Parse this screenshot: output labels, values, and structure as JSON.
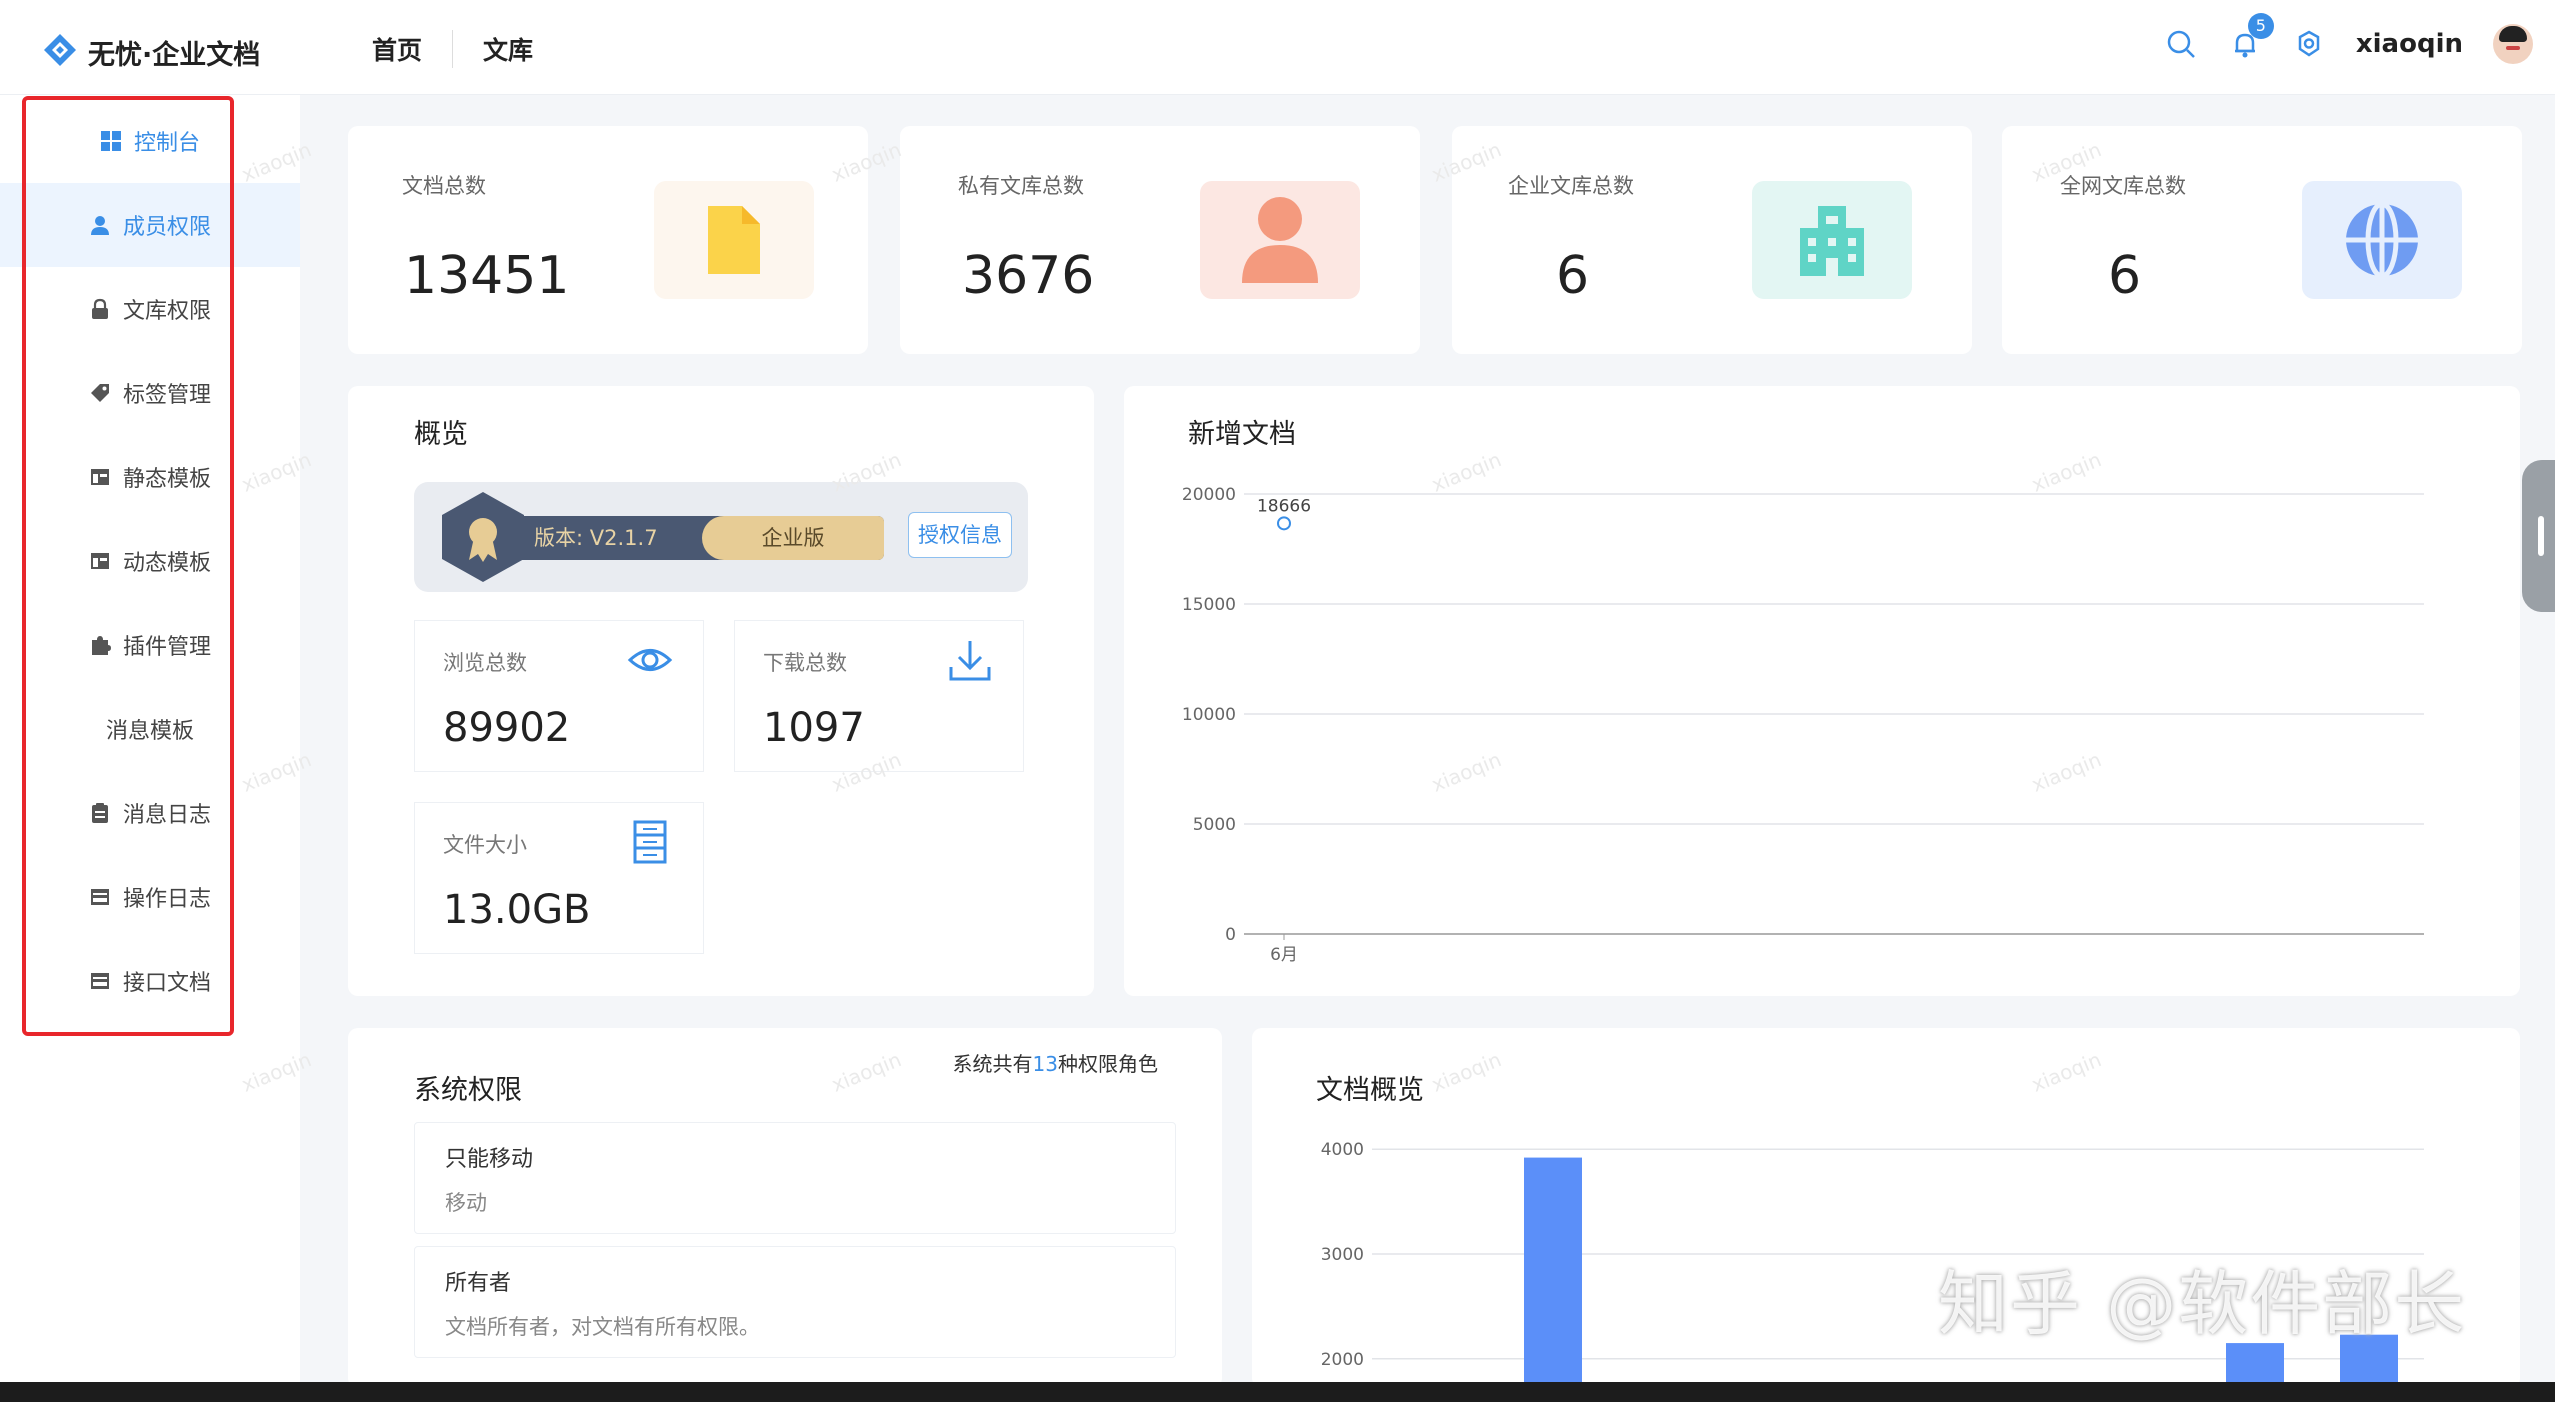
{
  "header": {
    "logo_text": "无忧·企业文档",
    "nav": [
      "首页",
      "文库"
    ],
    "notification_count": "5",
    "username": "xiaoqin"
  },
  "sidebar": {
    "items": [
      {
        "label": "控制台",
        "icon": "dashboard-icon"
      },
      {
        "label": "成员权限",
        "icon": "user-icon"
      },
      {
        "label": "文库权限",
        "icon": "lock-icon"
      },
      {
        "label": "标签管理",
        "icon": "tag-icon"
      },
      {
        "label": "静态模板",
        "icon": "template-icon"
      },
      {
        "label": "动态模板",
        "icon": "template-icon"
      },
      {
        "label": "插件管理",
        "icon": "puzzle-icon"
      },
      {
        "label": "消息模板",
        "icon": ""
      },
      {
        "label": "消息日志",
        "icon": "clipboard-icon"
      },
      {
        "label": "操作日志",
        "icon": "log-icon"
      },
      {
        "label": "接口文档",
        "icon": "api-doc-icon"
      }
    ]
  },
  "stats": [
    {
      "label": "文档总数",
      "value": "13451",
      "icon": "file-icon",
      "color": "#fbd34a",
      "bg": "#fdf6ee"
    },
    {
      "label": "私有文库总数",
      "value": "3676",
      "icon": "person-icon",
      "color": "#f49a7e",
      "bg": "#fce7e2"
    },
    {
      "label": "企业文库总数",
      "value": "6",
      "icon": "building-icon",
      "color": "#5fd4c6",
      "bg": "#e3f6f3"
    },
    {
      "label": "全网文库总数",
      "value": "6",
      "icon": "globe-icon",
      "color": "#6f9cf2",
      "bg": "#e6effd"
    }
  ],
  "overview": {
    "title": "概览",
    "version": "版本: V2.1.7",
    "edition": "企业版",
    "auth_button": "授权信息",
    "metrics": [
      {
        "label": "浏览总数",
        "value": "89902",
        "icon": "eye-icon"
      },
      {
        "label": "下载总数",
        "value": "1097",
        "icon": "download-icon"
      },
      {
        "label": "文件大小",
        "value": "13.0GB",
        "icon": "storage-icon"
      }
    ]
  },
  "new_docs": {
    "title": "新增文档"
  },
  "permissions": {
    "title": "系统权限",
    "summary_prefix": "系统共有",
    "summary_count": "13",
    "summary_suffix": "种权限角色",
    "items": [
      {
        "name": "只能移动",
        "desc": "移动"
      },
      {
        "name": "所有者",
        "desc": "文档所有者，对文档有所有权限。"
      }
    ]
  },
  "doc_overview": {
    "title": "文档概览"
  },
  "watermark_text": "xiaoqin",
  "overlay_text": "知乎 @软件部长",
  "chart_data": [
    {
      "type": "line",
      "title": "新增文档",
      "x": [
        "6月"
      ],
      "series": [
        {
          "values": [
            18666
          ]
        }
      ],
      "data_labels": [
        "18666"
      ],
      "ylim": [
        0,
        20000
      ],
      "yticks": [
        0,
        5000,
        10000,
        15000,
        20000
      ],
      "grid": true
    },
    {
      "type": "bar",
      "title": "文档概览",
      "bars_visible": [
        3920,
        2150,
        2230
      ],
      "yticks_visible": [
        2000,
        3000,
        4000
      ],
      "grid": true
    }
  ]
}
